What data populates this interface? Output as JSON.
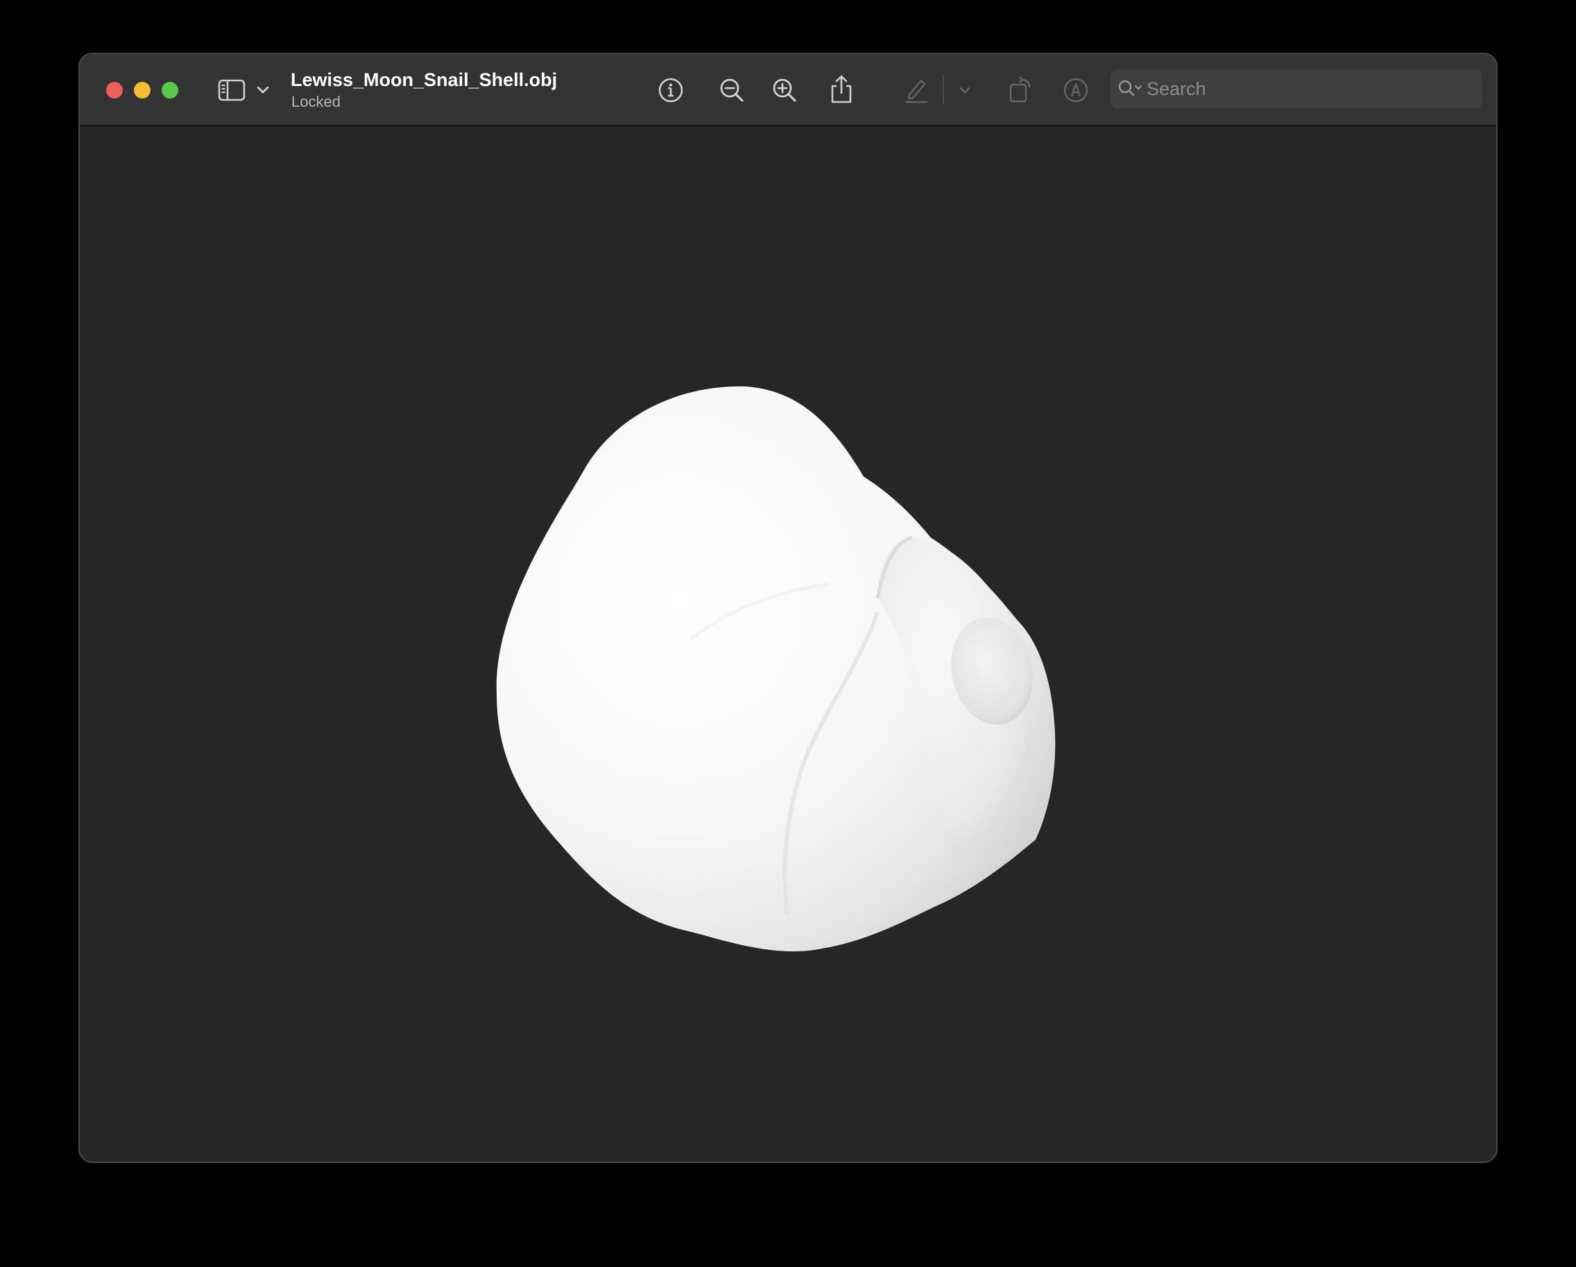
{
  "window": {
    "title": "Lewiss_Moon_Snail_Shell.obj",
    "subtitle": "Locked"
  },
  "toolbar": {
    "icons": [
      "sidebar-icon",
      "chevron-down-icon",
      "info-icon",
      "zoom-out-icon",
      "zoom-in-icon",
      "share-icon",
      "highlight-pen-icon",
      "chevron-down-icon",
      "rotate-icon",
      "markup-icon"
    ]
  },
  "search": {
    "placeholder": "Search",
    "value": ""
  },
  "viewer": {
    "model_name": "moon snail shell 3D model"
  },
  "colors": {
    "window_bg": "#262626",
    "titlebar_bg": "#333333",
    "close": "#ee5f57",
    "minimize": "#f5bd2f",
    "maximize": "#5ac84a"
  }
}
